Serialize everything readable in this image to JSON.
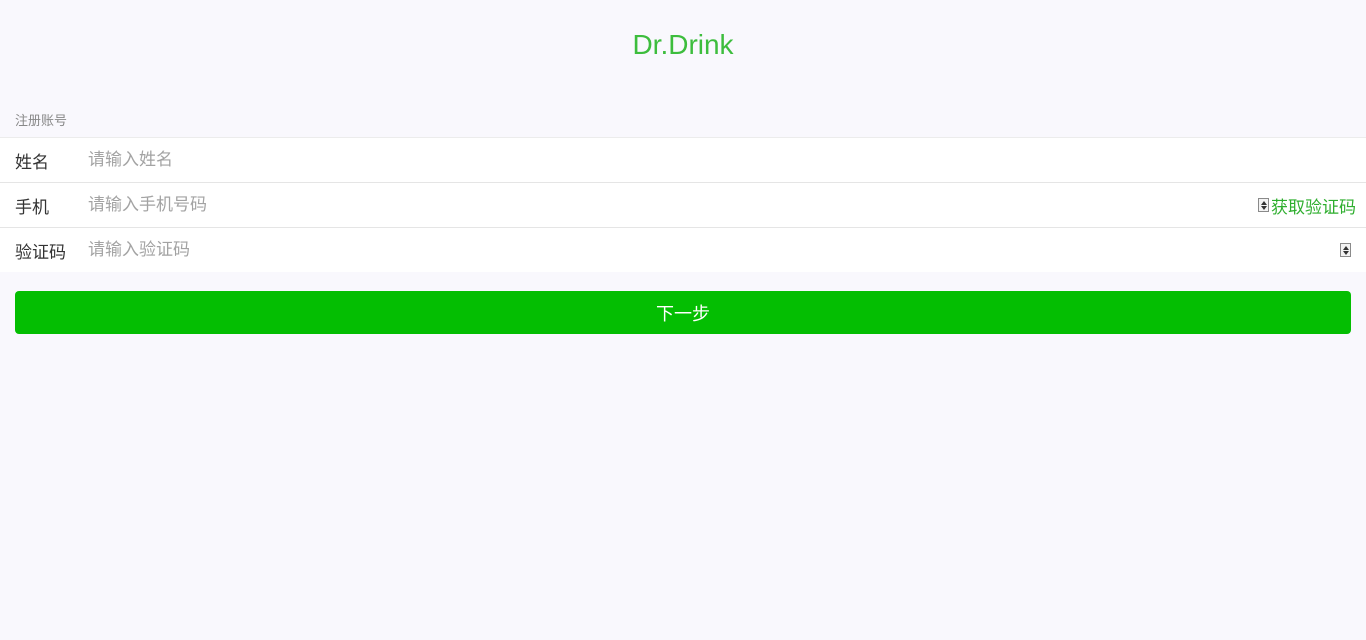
{
  "app": {
    "title": "Dr.Drink"
  },
  "section": {
    "label": "注册账号"
  },
  "form": {
    "name": {
      "label": "姓名",
      "placeholder": "请输入姓名"
    },
    "phone": {
      "label": "手机",
      "placeholder": "请输入手机号码",
      "get_code_label": "获取验证码"
    },
    "code": {
      "label": "验证码",
      "placeholder": "请输入验证码"
    }
  },
  "actions": {
    "next_label": "下一步"
  },
  "colors": {
    "brand_green": "#3dbd3d",
    "button_green": "#04be02",
    "link_green": "#2eae2e",
    "background": "#f9f8fd"
  }
}
